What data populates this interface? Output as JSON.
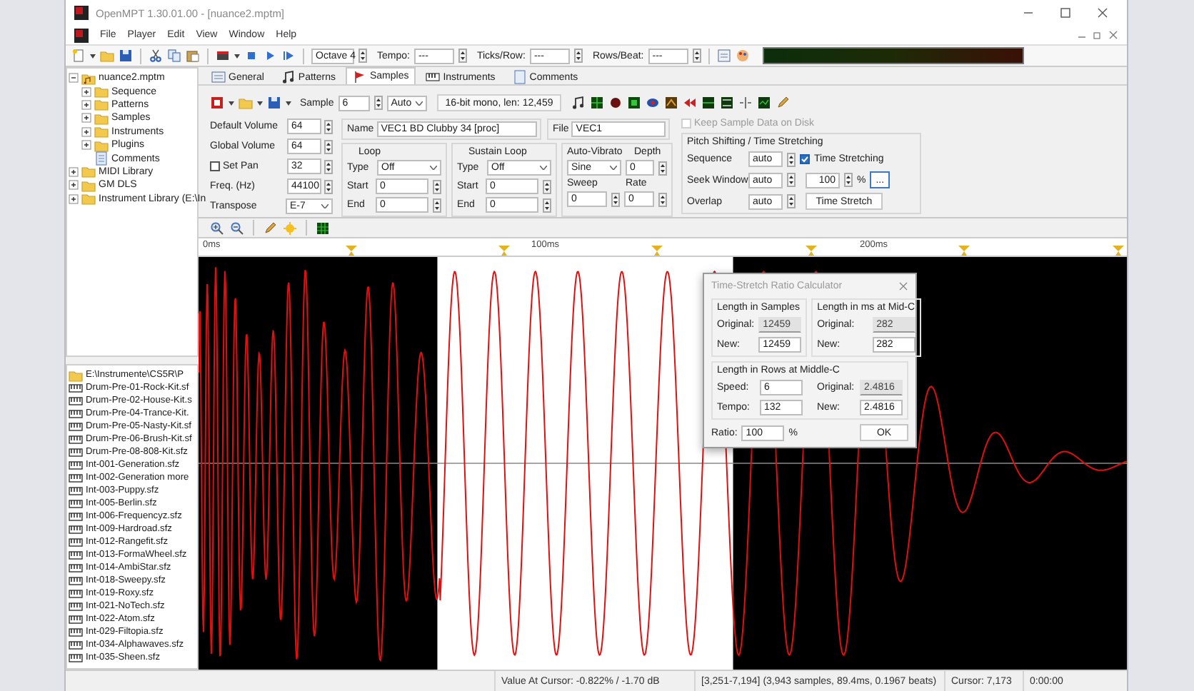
{
  "window": {
    "title": "OpenMPT 1.30.01.00 - [nuance2.mptm]"
  },
  "menu": [
    "File",
    "Player",
    "Edit",
    "View",
    "Window",
    "Help"
  ],
  "toolbar": {
    "octave": "Octave 4",
    "fields": [
      {
        "label": "Tempo:",
        "value": "---"
      },
      {
        "label": "Ticks/Row:",
        "value": "---"
      },
      {
        "label": "Rows/Beat:",
        "value": "---"
      }
    ]
  },
  "tree": [
    {
      "label": "nuance2.mptm",
      "kind": "song",
      "expanded": true,
      "children": [
        {
          "label": "Sequence",
          "kind": "folder",
          "expanded": false
        },
        {
          "label": "Patterns",
          "kind": "folder",
          "expanded": false
        },
        {
          "label": "Samples",
          "kind": "folder",
          "expanded": false
        },
        {
          "label": "Instruments",
          "kind": "folder",
          "expanded": false
        },
        {
          "label": "Plugins",
          "kind": "folder",
          "expanded": false
        },
        {
          "label": "Comments",
          "kind": "page"
        }
      ]
    },
    {
      "label": "MIDI Library",
      "kind": "folder",
      "expanded": false
    },
    {
      "label": "GM DLS",
      "kind": "folder",
      "expanded": false
    },
    {
      "label": "Instrument Library (E:\\In",
      "kind": "folder",
      "expanded": false
    }
  ],
  "file_browser": {
    "path": "E:\\Instrumente\\CS5R\\P",
    "files": [
      "Drum-Pre-01-Rock-Kit.sf",
      "Drum-Pre-02-House-Kit.s",
      "Drum-Pre-04-Trance-Kit.",
      "Drum-Pre-05-Nasty-Kit.sf",
      "Drum-Pre-06-Brush-Kit.sf",
      "Drum-Pre-08-808-Kit.sfz",
      "Int-001-Generation.sfz",
      "Int-002-Generation more",
      "Int-003-Puppy.sfz",
      "Int-005-Berlin.sfz",
      "Int-006-Frequencyz.sfz",
      "Int-009-Hardroad.sfz",
      "Int-012-Rangefit.sfz",
      "Int-013-FormaWheel.sfz",
      "Int-014-AmbiStar.sfz",
      "Int-018-Sweepy.sfz",
      "Int-019-Roxy.sfz",
      "Int-021-NoTech.sfz",
      "Int-022-Atom.sfz",
      "Int-029-Filtopia.sfz",
      "Int-034-Alphawaves.sfz",
      "Int-035-Sheen.sfz"
    ]
  },
  "tabs": [
    {
      "label": "General",
      "selected": false
    },
    {
      "label": "Patterns",
      "selected": false
    },
    {
      "label": "Samples",
      "selected": true
    },
    {
      "label": "Instruments",
      "selected": false
    },
    {
      "label": "Comments",
      "selected": false
    }
  ],
  "sample_bar": {
    "label": "Sample",
    "number": "6",
    "mode": "Auto",
    "info": "16-bit mono, len: 12,459"
  },
  "left_fields": [
    {
      "label": "Default Volume",
      "value": "64",
      "kind": "spin"
    },
    {
      "label": "Global Volume",
      "value": "64",
      "kind": "spin"
    },
    {
      "label": "Set Pan",
      "value": "32",
      "kind": "check",
      "checked": false
    },
    {
      "label": "Freq. (Hz)",
      "value": "44100",
      "kind": "spin"
    },
    {
      "label": "Transpose",
      "value": "E-7",
      "kind": "select"
    }
  ],
  "name": {
    "label": "Name",
    "value": "VEC1 BD Clubby 34  [proc]"
  },
  "file": {
    "label": "File",
    "value": "VEC1"
  },
  "loops": [
    {
      "title": "Loop",
      "type_label": "Type",
      "type": "Off",
      "start_label": "Start",
      "start": "0",
      "end_label": "End",
      "end": "0"
    },
    {
      "title": "Sustain Loop",
      "type_label": "Type",
      "type": "Off",
      "start_label": "Start",
      "start": "0",
      "end_label": "End",
      "end": "0"
    }
  ],
  "auto_vibrato": {
    "title": "Auto-Vibrato",
    "waveform": "Sine",
    "depth_label": "Depth",
    "depth": "0",
    "sweep_label": "Sweep",
    "sweep": "0",
    "rate_label": "Rate",
    "rate": "0"
  },
  "keep_on_disk": {
    "label": "Keep Sample Data on Disk",
    "checked": false,
    "disabled": true
  },
  "pitch": {
    "title": "Pitch Shifting / Time Stretching",
    "sequence_label": "Sequence",
    "sequence": "auto",
    "time_stretching": {
      "label": "Time Stretching",
      "checked": true
    },
    "seek_label": "Seek Window",
    "seek": "auto",
    "ratio": "100",
    "ratio_unit": "%",
    "more_button": "...",
    "overlap_label": "Overlap",
    "overlap": "auto",
    "button": "Time Stretch"
  },
  "ruler": [
    "0ms",
    "100ms",
    "200ms"
  ],
  "dialog": {
    "title": "Time-Stretch Ratio Calculator",
    "groups": [
      {
        "title": "Length in Samples",
        "fields": [
          {
            "label": "Original:",
            "value": "12459",
            "readonly": true
          },
          {
            "label": "New:",
            "value": "12459",
            "readonly": false
          }
        ]
      },
      {
        "title": "Length in ms at Mid-C",
        "fields": [
          {
            "label": "Original:",
            "value": "282",
            "readonly": true
          },
          {
            "label": "New:",
            "value": "282",
            "readonly": false
          }
        ]
      }
    ],
    "rows_group": {
      "title": "Length in Rows at Middle-C",
      "fields": [
        {
          "label": "Speed:",
          "value": "6",
          "readonly": false
        },
        {
          "label": "Original:",
          "value": "2.4816",
          "readonly": true
        },
        {
          "label": "Tempo:",
          "value": "132",
          "readonly": false
        },
        {
          "label": "New:",
          "value": "2.4816",
          "readonly": false
        }
      ]
    },
    "ratio": {
      "label": "Ratio:",
      "value": "100",
      "unit": "%"
    },
    "ok": "OK"
  },
  "status": [
    "Value At Cursor: -0.822% / -1.70 dB",
    "[3,251-7,194] (3,943 samples, 89.4ms, 0.1967 beats)",
    "Cursor: 7,173",
    "0:00:00"
  ]
}
